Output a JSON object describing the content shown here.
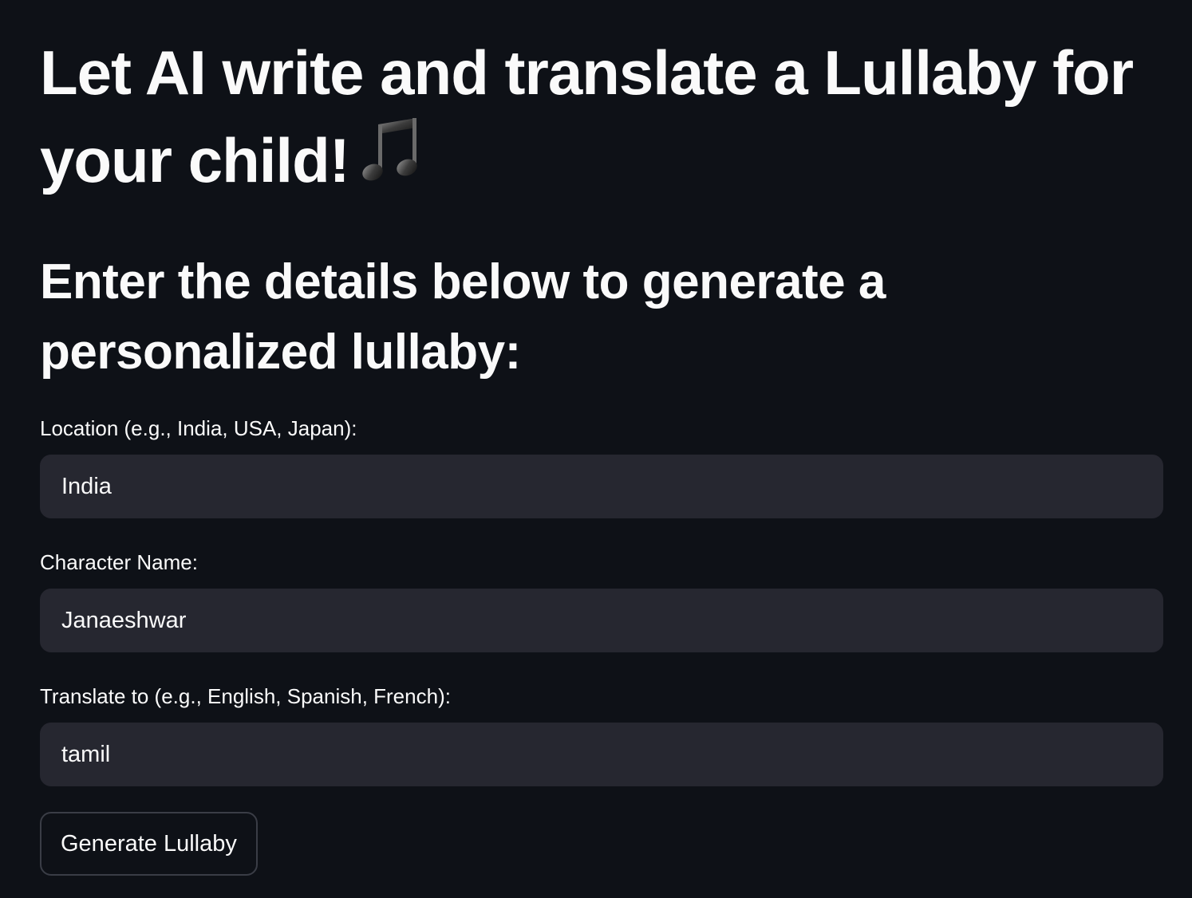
{
  "title": {
    "text": "Let AI write and translate a Lullaby for your child!",
    "emoji_icon": "musical-notes-icon"
  },
  "subtitle": "Enter the details below to generate a personalized lullaby:",
  "form": {
    "location": {
      "label": "Location (e.g., India, USA, Japan):",
      "value": "India"
    },
    "character": {
      "label": "Character Name:",
      "value": "Janaeshwar"
    },
    "language": {
      "label": "Translate to (e.g., English, Spanish, French):",
      "value": "tamil"
    },
    "submit_label": "Generate Lullaby"
  },
  "colors": {
    "background": "#0e1117",
    "input_background": "#262730",
    "text": "#fafafa",
    "button_border": "#3a3d46"
  }
}
